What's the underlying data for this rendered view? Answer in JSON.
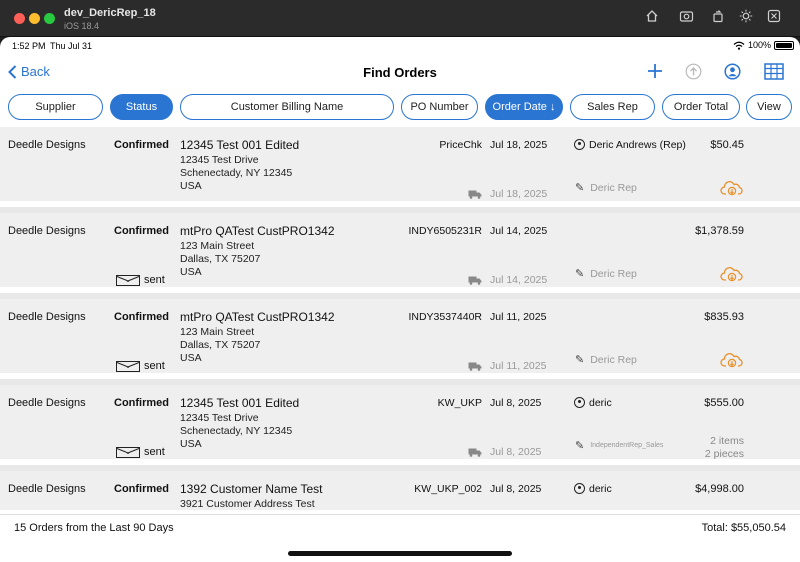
{
  "window": {
    "title": "dev_DericRep_18",
    "subtitle": "iOS 18.4"
  },
  "statusbar": {
    "time": "1:52 PM",
    "date": "Thu Jul 31",
    "battery": "100%"
  },
  "nav": {
    "back_label": "Back",
    "title": "Find Orders"
  },
  "filters": [
    {
      "label": "Supplier",
      "active": false
    },
    {
      "label": "Status",
      "active": true
    },
    {
      "label": "Customer Billing Name",
      "active": false
    },
    {
      "label": "PO Number",
      "active": false
    },
    {
      "label": "Order Date ↓",
      "active": true
    },
    {
      "label": "Sales Rep",
      "active": false
    },
    {
      "label": "Order Total",
      "active": false
    },
    {
      "label": "View",
      "active": false
    }
  ],
  "orders": [
    {
      "supplier": "Deedle Designs",
      "status": "Confirmed",
      "sent": "",
      "customer": "12345 Test 001 Edited",
      "addr1": "12345 Test Drive",
      "addr2": "Schenectady, NY  12345",
      "addr3": "USA",
      "po": "PriceChk",
      "order_date": "Jul 18, 2025",
      "ship_date": "Jul 18, 2025",
      "rep": "Deric Andrews (Rep)",
      "assigned": "Deric Rep",
      "total": "$50.45",
      "items": "",
      "pieces": ""
    },
    {
      "supplier": "Deedle Designs",
      "status": "Confirmed",
      "sent": "sent",
      "customer": "mtPro QATest CustPRO1342",
      "addr1": "123 Main Street",
      "addr2": "Dallas, TX  75207",
      "addr3": "USA",
      "po": "INDY6505231R",
      "order_date": "Jul 14, 2025",
      "ship_date": "Jul 14, 2025",
      "rep": "",
      "assigned": "Deric Rep",
      "total": "$1,378.59",
      "items": "",
      "pieces": ""
    },
    {
      "supplier": "Deedle Designs",
      "status": "Confirmed",
      "sent": "sent",
      "customer": "mtPro QATest CustPRO1342",
      "addr1": "123 Main Street",
      "addr2": "Dallas, TX  75207",
      "addr3": "USA",
      "po": "INDY3537440R",
      "order_date": "Jul 11, 2025",
      "ship_date": "Jul 11, 2025",
      "rep": "",
      "assigned": "Deric Rep",
      "total": "$835.93",
      "items": "",
      "pieces": ""
    },
    {
      "supplier": "Deedle Designs",
      "status": "Confirmed",
      "sent": "sent",
      "customer": "12345 Test 001 Edited",
      "addr1": "12345 Test Drive",
      "addr2": "Schenectady, NY  12345",
      "addr3": "USA",
      "po": "KW_UKP",
      "order_date": "Jul 8, 2025",
      "ship_date": "Jul 8, 2025",
      "rep": "deric",
      "assigned": "IndependentRep_Sales",
      "total": "$555.00",
      "items": "2 items",
      "pieces": "2 pieces"
    },
    {
      "supplier": "Deedle Designs",
      "status": "Confirmed",
      "sent": "",
      "customer": "1392 Customer Name Test",
      "addr1": "3921 Customer Address Test",
      "addr2": "",
      "addr3": "",
      "po": "KW_UKP_002",
      "order_date": "Jul 8, 2025",
      "ship_date": "",
      "rep": "deric",
      "assigned": "",
      "total": "$4,998.00",
      "items": "",
      "pieces": ""
    }
  ],
  "footer": {
    "summary": "15 Orders from the Last 90 Days",
    "total": "Total: $55,050.54"
  },
  "colors": {
    "accent": "#2a75d2",
    "cloud": "#e8902a"
  }
}
